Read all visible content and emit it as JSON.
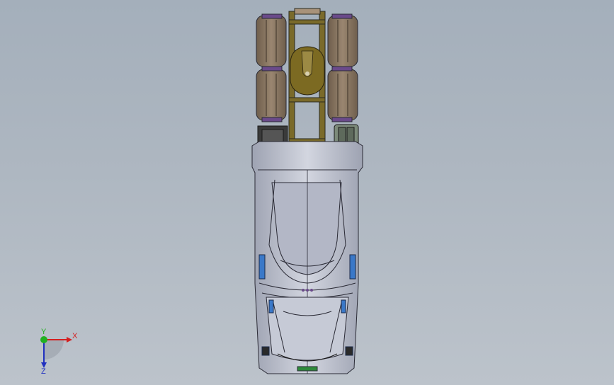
{
  "viewport": {
    "background_top": "#a4afbb",
    "background_bottom": "#bcc3cb"
  },
  "model": {
    "view": "bottom",
    "colors": {
      "cab_body": "#c2c6d3",
      "cab_outline": "#2a2a35",
      "frame_rail": "#7a6a2a",
      "tire": "#8c7a66",
      "fifth_wheel": "#7c6a22",
      "fuel_tank": "#2e8a3a",
      "battery_box": "#3a3a3a",
      "air_tank": "#7c8a7a",
      "wheel_hub": "#6a4a8a",
      "mirror_blue": "#3a78c8"
    }
  },
  "triad": {
    "x_label": "X",
    "y_label": "Y",
    "z_label": "Z",
    "x_color": "#d42020",
    "y_color": "#20b020",
    "z_color": "#2030c0"
  }
}
